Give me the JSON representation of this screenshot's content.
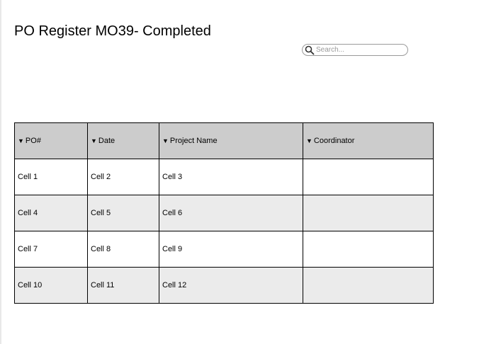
{
  "page": {
    "title": "PO Register MO39- Completed"
  },
  "search": {
    "placeholder": "Search...",
    "value": "",
    "icon": "search-icon"
  },
  "table": {
    "sort_icon": "sort-down-arrow-icon",
    "header_bg": "#cccccc",
    "alt_row_bg": "#ebebeb",
    "columns": [
      {
        "label": "PO#"
      },
      {
        "label": "Date"
      },
      {
        "label": "Project Name"
      },
      {
        "label": "Coordinator"
      }
    ],
    "rows": [
      [
        "Cell 1",
        "Cell 2",
        "Cell 3",
        ""
      ],
      [
        "Cell 4",
        "Cell 5",
        "Cell 6",
        ""
      ],
      [
        "Cell 7",
        "Cell 8",
        "Cell 9",
        ""
      ],
      [
        "Cell 10",
        "Cell 11",
        "Cell 12",
        ""
      ]
    ]
  }
}
